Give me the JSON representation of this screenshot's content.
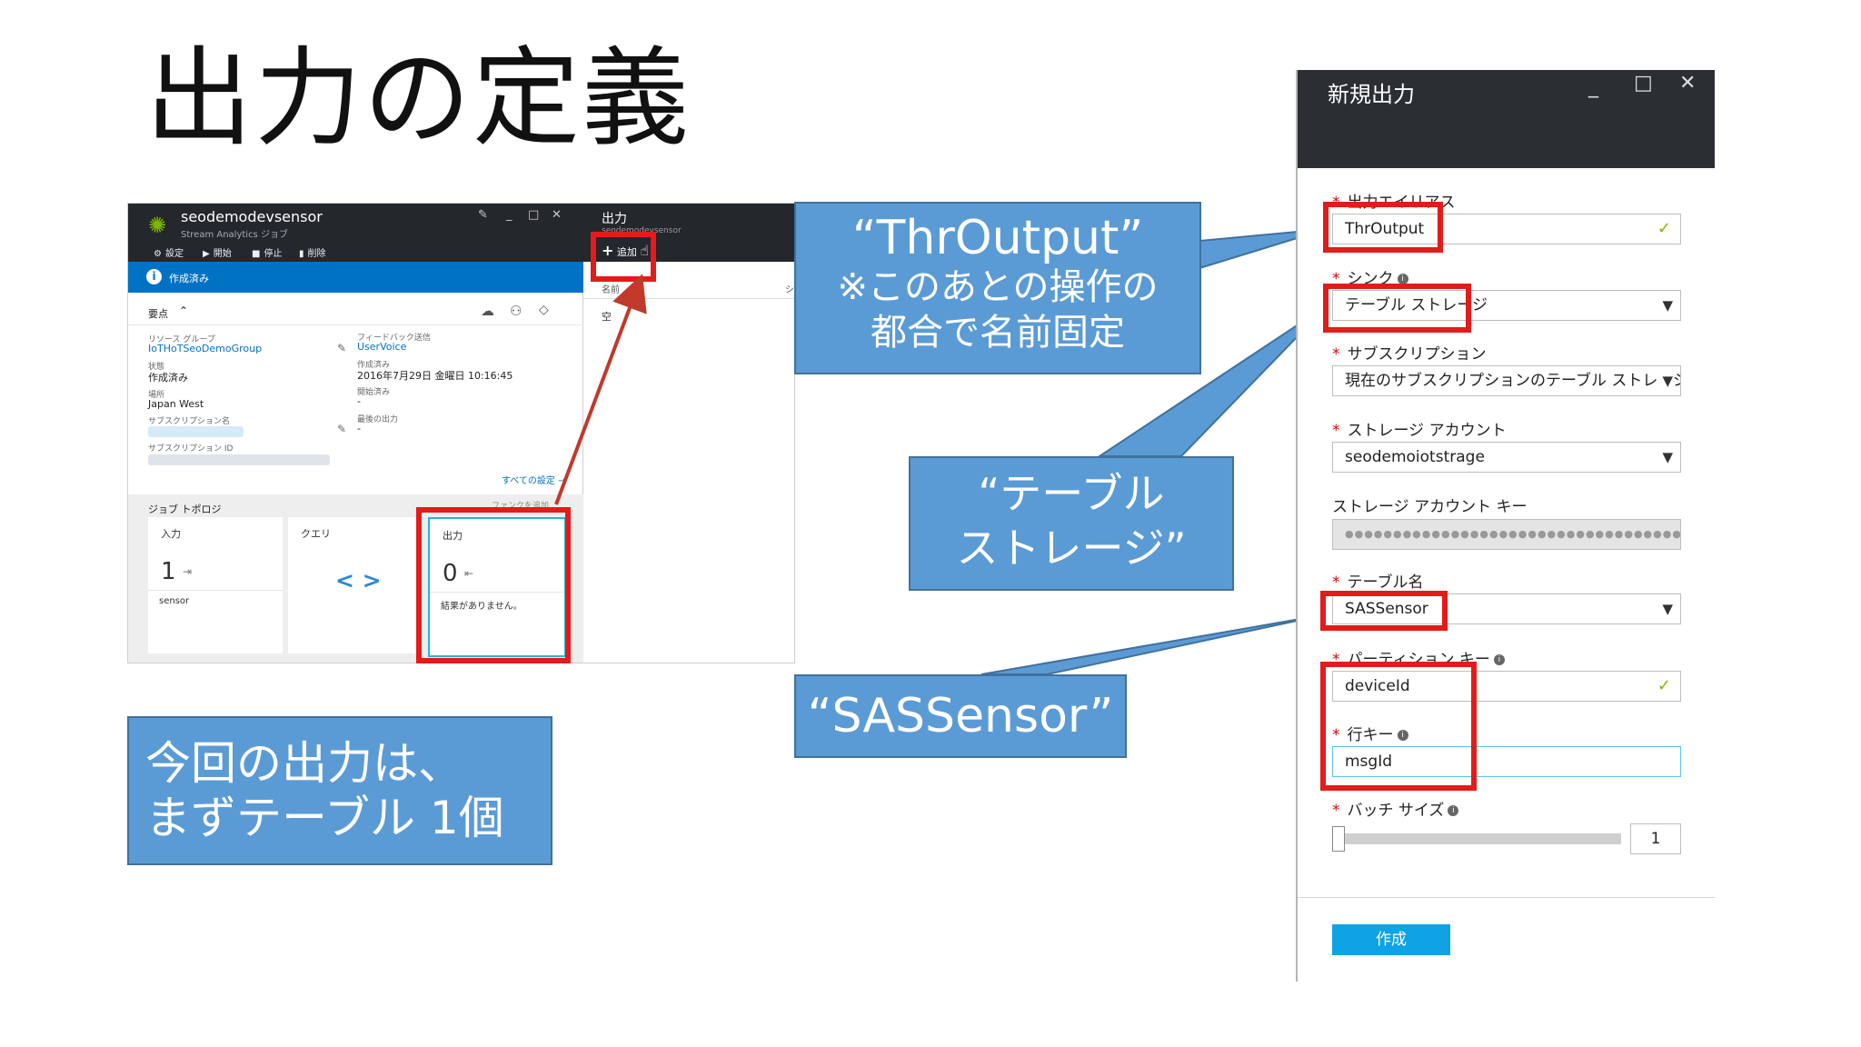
{
  "slide": {
    "title": "出力の定義"
  },
  "portal": {
    "job": {
      "name": "seodemodevsensor",
      "subtitle": "Stream Analytics ジョブ",
      "toolbar": [
        {
          "label": "設定",
          "icon": "gear-icon"
        },
        {
          "label": "開始",
          "icon": "play-icon"
        },
        {
          "label": "停止",
          "icon": "stop-icon"
        },
        {
          "label": "削除",
          "icon": "trash-icon"
        }
      ],
      "status": "作成済み",
      "essentials_label": "要点",
      "resource_group_label": "リソース グループ",
      "resource_group_value": "IoTHoTSeoDemoGroup",
      "status_label": "状態",
      "status_value": "作成済み",
      "location_label": "場所",
      "location_value": "Japan West",
      "subscription_name_label": "サブスクリプション名",
      "subscription_id_label": "サブスクリプション ID",
      "feedback_label": "フィードバック送信",
      "feedback_value": "UserVoice",
      "created_label": "作成済み",
      "created_value": "2016年7月29日 金曜日 10:16:45",
      "started_label": "開始済み",
      "started_value": "-",
      "last_output_label": "最後の出力",
      "last_output_value": "-",
      "all_settings_link": "すべての設定 →",
      "topology_label": "ジョブ トポロジ",
      "add_function_link": "ファンクを追加",
      "tiles": {
        "input": {
          "title": "入力",
          "count": "1",
          "foot": "sensor"
        },
        "query": {
          "title": "クエリ",
          "glyph": "< >"
        },
        "output": {
          "title": "出力",
          "count": "0",
          "foot": "結果がありません。"
        }
      }
    },
    "outputs_blade": {
      "title": "出力",
      "subtitle": "seodemodevsensor",
      "add_label": "追加",
      "col_name": "名前",
      "col_sink": "シ",
      "empty": "空"
    }
  },
  "callouts": {
    "throutput": {
      "line1": "“ThrOutput”",
      "line2": "※このあとの操作の",
      "line3": "都合で名前固定"
    },
    "table_storage": {
      "line1": "“テーブル",
      "line2": "ストレージ”"
    },
    "sassensor": {
      "line1": "“SASSensor”"
    },
    "summary": {
      "line1": "今回の出力は、",
      "line2": "まずテーブル 1個"
    }
  },
  "new_output": {
    "title": "新規出力",
    "alias_label": "出力エイリアス",
    "alias_value": "ThrOutput",
    "sink_label": "シンク",
    "sink_value": "テーブル ストレージ",
    "subscription_label": "サブスクリプション",
    "subscription_value": "現在のサブスクリプションのテーブル ストレージを…",
    "storage_account_label": "ストレージ アカウント",
    "storage_account_value": "seodemoiotstrage",
    "storage_key_label": "ストレージ アカウント キー",
    "storage_key_value": "●●●●●●●●●●●●●●●●●●●●●●●●●●●●●●●●●●●",
    "table_name_label": "テーブル名",
    "table_name_value": "SASSensor",
    "partition_key_label": "パーティション キー",
    "partition_key_value": "deviceId",
    "row_key_label": "行キー",
    "row_key_value": "msgId",
    "batch_size_label": "バッチ サイズ",
    "batch_size_value": "1",
    "batch_size_level": 0,
    "create_label": "作成",
    "accent_color": "#0fa3e6"
  }
}
